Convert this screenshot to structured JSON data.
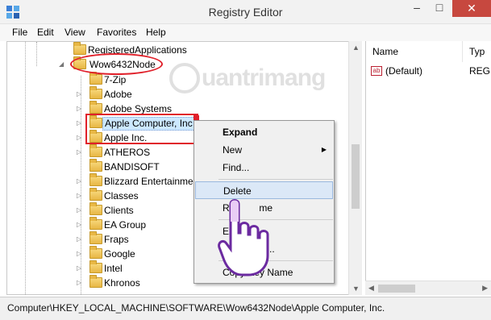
{
  "window": {
    "title": "Registry Editor"
  },
  "menu": [
    "File",
    "Edit",
    "View",
    "Favorites",
    "Help"
  ],
  "tree": {
    "top_item": "RegisteredApplications",
    "parent": "Wow6432Node",
    "children": [
      "7-Zip",
      "Adobe",
      "Adobe Systems",
      "Apple Computer, Inc",
      "Apple Inc.",
      "ATHEROS",
      "BANDISOFT",
      "Blizzard Entertainmen",
      "Classes",
      "Clients",
      "EA Group",
      "Fraps",
      "Google",
      "Intel",
      "Khronos"
    ],
    "selected": "Apple Computer, Inc"
  },
  "right_pane": {
    "columns": [
      "Name",
      "Typ"
    ],
    "rows": [
      {
        "name": "(Default)",
        "type": "REG",
        "icon": "ab-string-icon"
      }
    ]
  },
  "context_menu": {
    "items": [
      {
        "label": "Expand",
        "bold": true
      },
      {
        "label": "New",
        "submenu": true
      },
      {
        "label": "Find..."
      },
      {
        "label": "Delete",
        "highlighted": true
      },
      {
        "label": "Re",
        "suffix": "me"
      },
      {
        "label": "Ex"
      },
      {
        "label": "Pe",
        "suffix": "s..."
      },
      {
        "label": "Copy Key Name"
      }
    ]
  },
  "status": {
    "path": "Computer\\HKEY_LOCAL_MACHINE\\SOFTWARE\\Wow6432Node\\Apple Computer, Inc."
  },
  "watermark": {
    "text": "uantrimang"
  },
  "colors": {
    "annotation_red": "#e0202a",
    "selection": "#cce8ff",
    "close_button": "#c7483f"
  }
}
